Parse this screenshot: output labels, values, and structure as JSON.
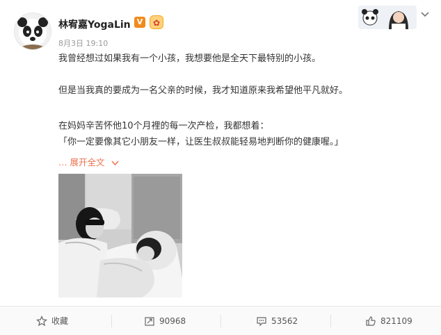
{
  "post": {
    "author": "林宥嘉YogaLin",
    "verified_badge": "V",
    "date": "8月3日",
    "time": "19:10",
    "paragraphs": [
      "我曾经想过如果我有一个小孩，我想要他是全天下最特别的小孩。",
      "但是当我真的要成为一名父亲的时候，我才知道原来我希望他平凡就好。",
      "在妈妈辛苦怀他10个月裡的每一次产检，我都想着：",
      "「你一定要像其它小朋友一样，让医生叔叔能轻易地判断你的健康喔。」"
    ],
    "expand_label": "展开全文"
  },
  "actions": {
    "favorite_label": "收藏",
    "repost_count": "90968",
    "comment_count": "53562",
    "like_count": "821109"
  },
  "icons": {
    "expand_menu": "chevron-down-icon",
    "favorite": "star-icon",
    "repost": "repost-icon",
    "comment": "comment-icon",
    "like": "thumbs-up-icon"
  },
  "colors": {
    "link": "#eb7350",
    "verified": "#f08a1c"
  }
}
